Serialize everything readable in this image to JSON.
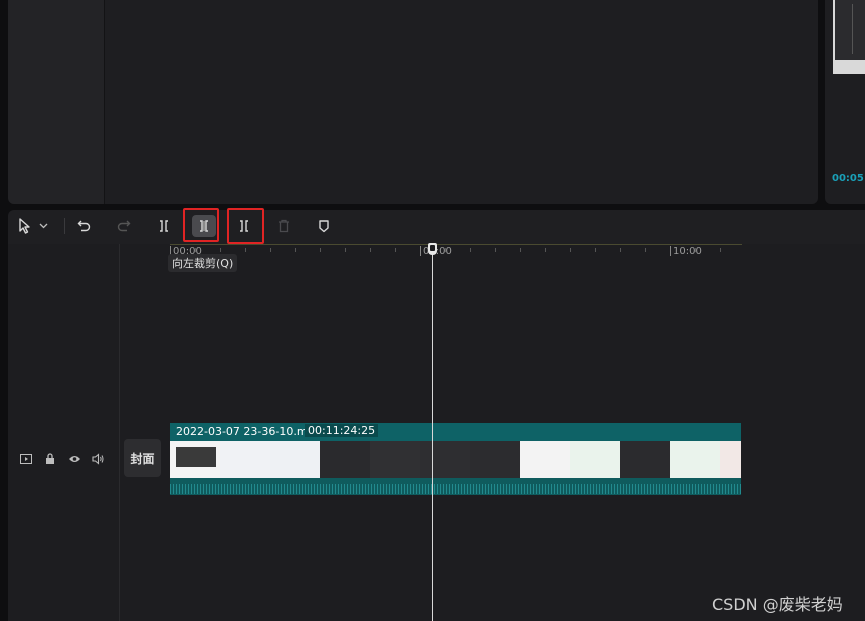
{
  "preview": {
    "right_time": "00:05:"
  },
  "toolbar": {
    "select_tool": "pointer-icon",
    "select_dropdown": "chevron-down-icon",
    "undo": "undo-icon",
    "redo": "redo-icon",
    "split": "split-icon",
    "trim_left": "trim-left-icon",
    "trim_right": "trim-right-icon",
    "delete": "delete-icon",
    "marker": "marker-icon",
    "tooltip": "向左裁剪(Q)"
  },
  "ruler": {
    "labels": [
      "00:00",
      "05:00",
      "10:00"
    ]
  },
  "track": {
    "icons": [
      "video-track-icon",
      "lock-icon",
      "eye-icon",
      "audio-icon"
    ],
    "cover_label": "封面"
  },
  "clip": {
    "name": "2022-03-07 23-36-10.mkv",
    "duration": "00:11:24:25"
  },
  "watermark": "CSDN @废柴老妈",
  "colors": {
    "accent": "#0e6266",
    "highlight": "#e02424",
    "playhead": "#d8d8d8"
  }
}
